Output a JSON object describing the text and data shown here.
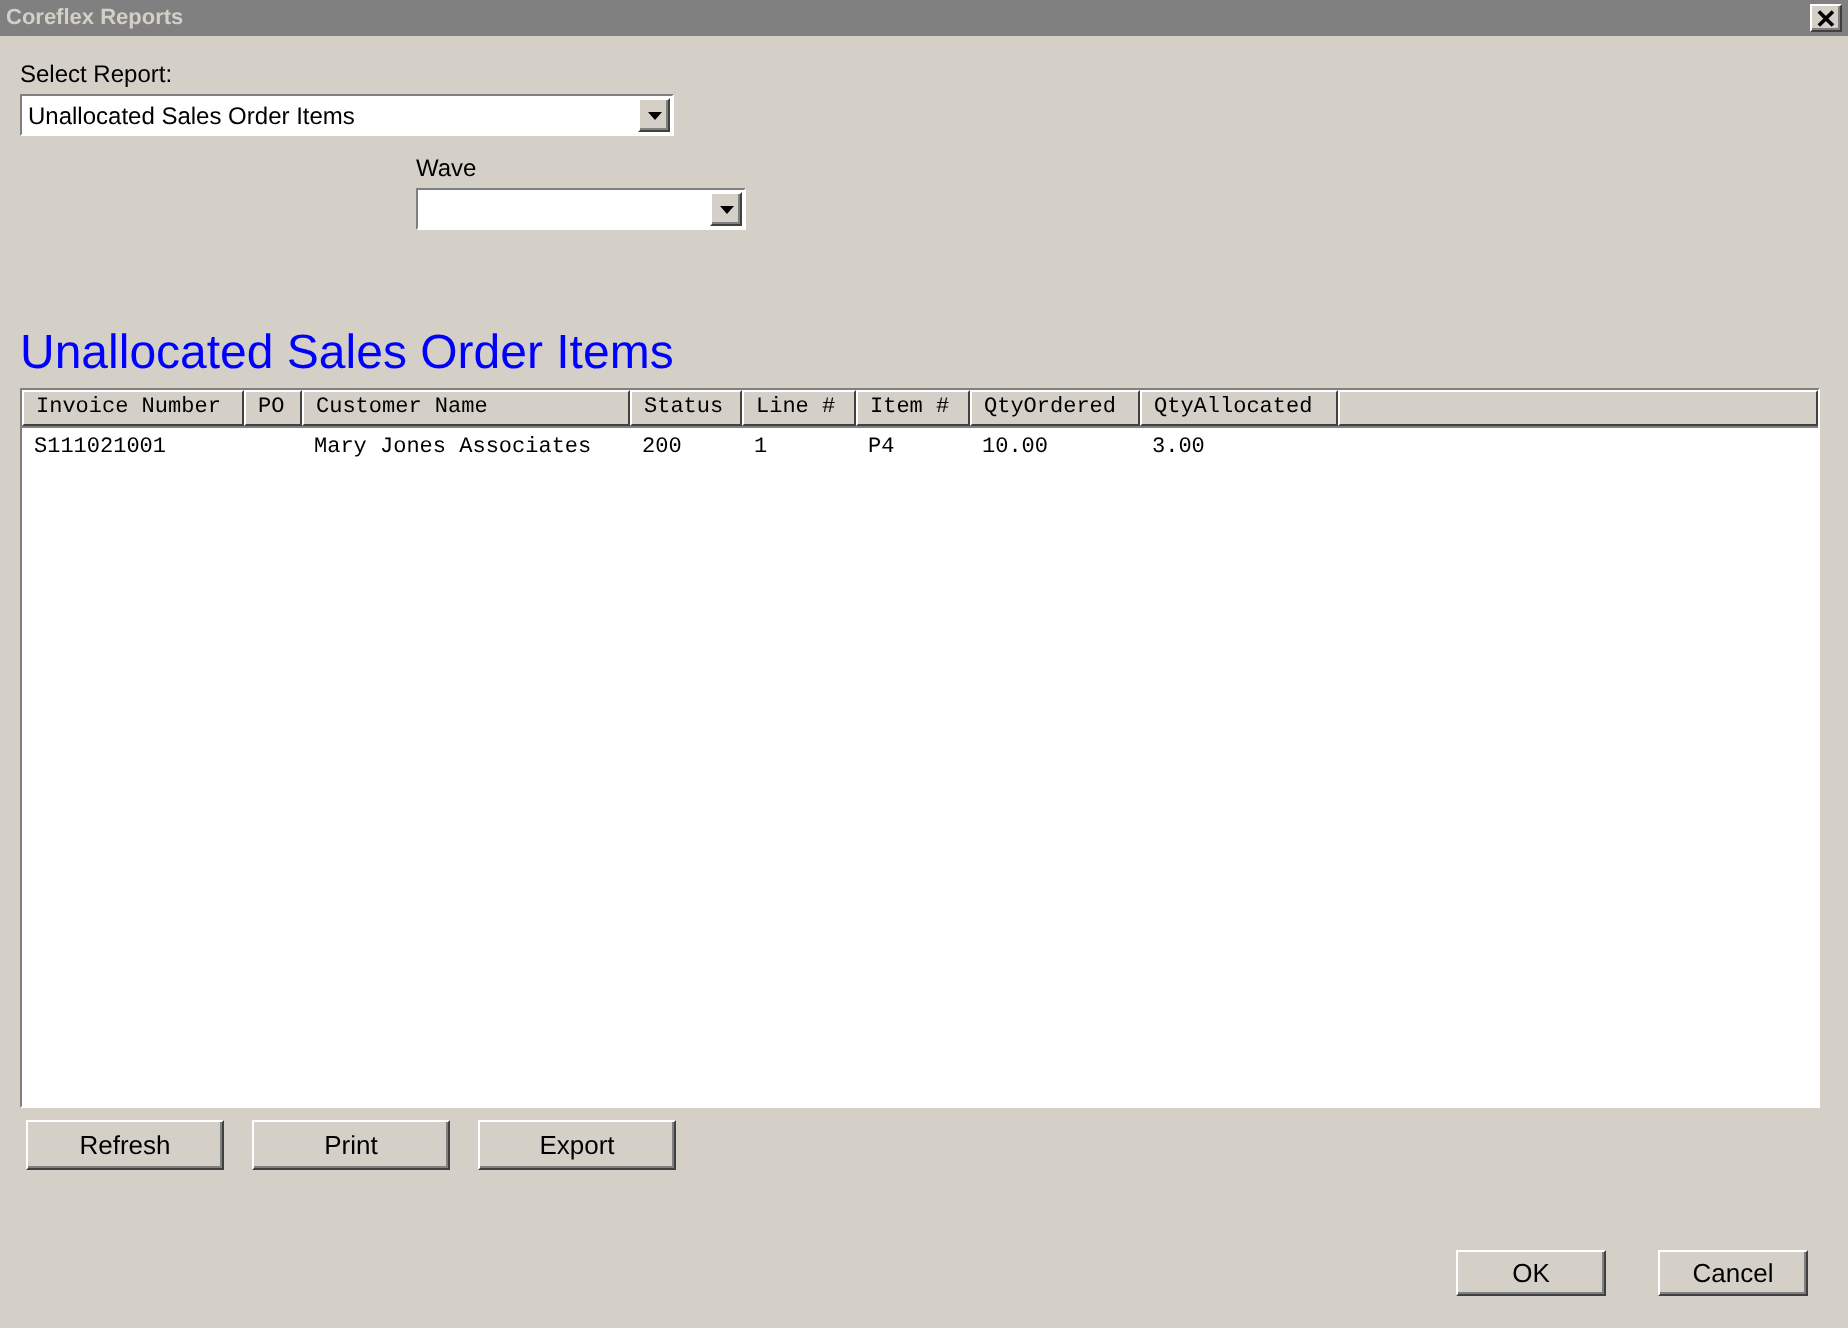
{
  "window": {
    "title": "Coreflex Reports",
    "close": "✕"
  },
  "report_select": {
    "label": "Select Report:",
    "value": "Unallocated Sales Order Items"
  },
  "wave_select": {
    "label": "Wave"
  },
  "report_title": "Unallocated Sales Order Items",
  "table": {
    "columns": [
      "Invoice Number",
      "PO",
      "Customer Name",
      "Status",
      "Line #",
      "Item #",
      "QtyOrdered",
      "QtyAllocated"
    ],
    "rows": [
      [
        "S111021001",
        "",
        "Mary Jones Associates",
        "200",
        "1",
        "P4",
        "10.00",
        "3.00"
      ]
    ]
  },
  "actions": [
    "Refresh",
    "Print",
    "Export"
  ],
  "dialog_buttons": [
    "OK",
    "Cancel"
  ]
}
